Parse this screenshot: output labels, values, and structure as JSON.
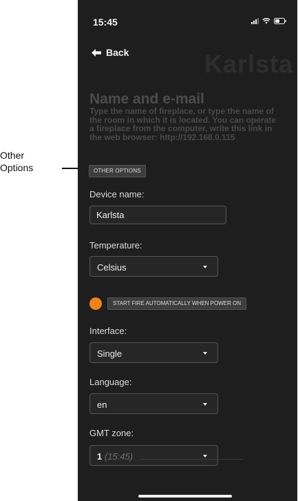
{
  "annotation": {
    "label": "Other\nOptions"
  },
  "status_bar": {
    "time": "15:45"
  },
  "nav": {
    "back_label": "Back",
    "brand": "Karlsta"
  },
  "section": {
    "title": "Name and e-mail",
    "description": "Type the name of fireplace, or type the name of the room in which it is located. You can operate a fireplace from the computer, write this link in the web browser: http://192.168.0.115"
  },
  "other_options_label": "OTHER OPTIONS",
  "device_name": {
    "label": "Device name:",
    "value": "Karlsta"
  },
  "temperature": {
    "label": "Temperature:",
    "value": "Celsius"
  },
  "auto_start": {
    "label": "START FIRE AUTOMATICALLY WHEN POWER ON",
    "on": true,
    "color": "#f0821e"
  },
  "interface": {
    "label": "Interface:",
    "value": "Single"
  },
  "language": {
    "label": "Language:",
    "value": "en"
  },
  "gmt_zone": {
    "label": "GMT zone:",
    "value": "1",
    "time_hint": "(15:45)"
  },
  "colors": {
    "background": "#1e1e1e",
    "accent": "#f0821e"
  }
}
